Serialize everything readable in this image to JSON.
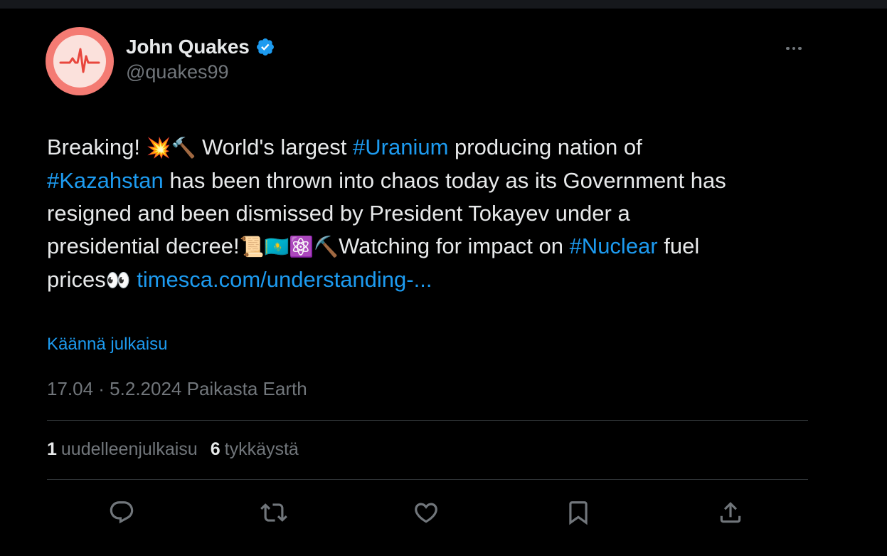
{
  "author": {
    "display_name": "John Quakes",
    "handle": "@quakes99",
    "verified": true,
    "avatar_icon": "seismograph-heartbeat-icon"
  },
  "tweet": {
    "line1": {
      "t1": "Breaking! ",
      "e1": "💥",
      "e2": "🔨",
      "t2": " World's largest ",
      "tag1": "#Uranium",
      "t3": " producing nation of"
    },
    "line2": {
      "tag": "#Kazahstan",
      "t": " has been thrown into chaos today as its Government has"
    },
    "line3": "resigned and been dismissed by President Tokayev under a",
    "line4": {
      "t1": "presidential decree!",
      "e1": "📜",
      "e2": "🇰🇿",
      "e3": "⚛️",
      "e4": "⛏️",
      "t2": "Watching for impact on ",
      "tag": "#Nuclear",
      "t3": " fuel"
    },
    "line5": {
      "t1": "prices",
      "e1": "👀",
      "link": "timesca.com/understanding-..."
    }
  },
  "translate_label": "Käännä julkaisu",
  "meta": "17.04 · 5.2.2024 Paikasta Earth",
  "stats": {
    "reposts_count": "1",
    "reposts_label": "uudelleenjulkaisu",
    "likes_count": "6",
    "likes_label": "tykkäystä"
  },
  "actions": [
    "reply-icon",
    "repost-icon",
    "like-icon",
    "bookmark-icon",
    "share-icon"
  ],
  "colors": {
    "background": "#000000",
    "text": "#e7e9ea",
    "secondary": "#71767b",
    "accent": "#1d9bf0",
    "divider": "#2f3336",
    "avatar": "#f47b73"
  }
}
